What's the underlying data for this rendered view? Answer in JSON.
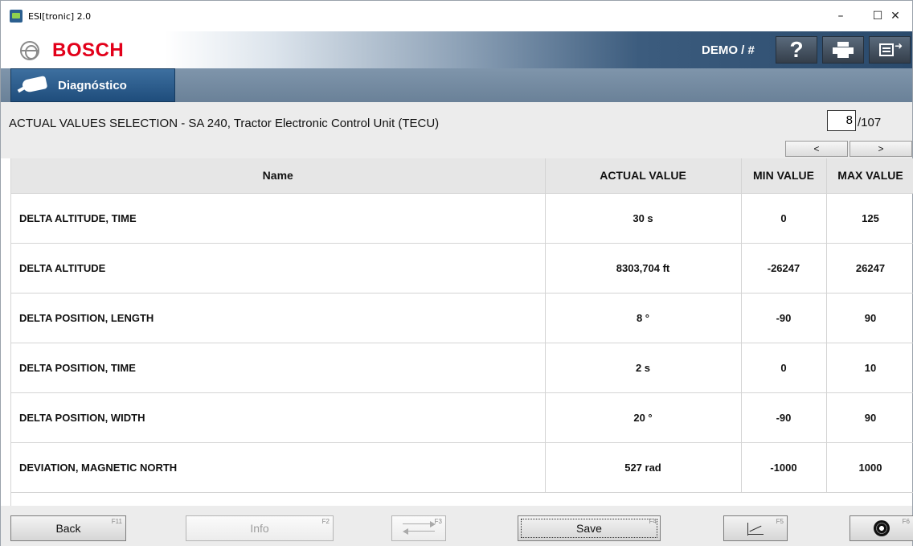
{
  "window": {
    "title": "ESI[tronic] 2.0",
    "minimize": "–",
    "maximize": "☐",
    "close": "✕"
  },
  "header": {
    "brand": "BOSCH",
    "user": "DEMO / #",
    "help_label": "?"
  },
  "nav": {
    "tab_label": "Diagnóstico"
  },
  "section": {
    "title": "ACTUAL VALUES SELECTION - SA 240, Tractor Electronic Control Unit (TECU)",
    "page_current": "8",
    "page_total": "/107",
    "prev_label": "<",
    "next_label": ">"
  },
  "table": {
    "headers": {
      "name": "Name",
      "actual": "ACTUAL VALUE",
      "min": "MIN VALUE",
      "max": "MAX VALUE"
    },
    "rows": [
      {
        "name": "DELTA ALTITUDE, TIME",
        "actual": "30 s",
        "min": "0",
        "max": "125"
      },
      {
        "name": "DELTA ALTITUDE",
        "actual": "8303,704 ft",
        "min": "-26247",
        "max": "26247"
      },
      {
        "name": "DELTA POSITION, LENGTH",
        "actual": "8 °",
        "min": "-90",
        "max": "90"
      },
      {
        "name": "DELTA POSITION, TIME",
        "actual": "2 s",
        "min": "0",
        "max": "10"
      },
      {
        "name": "DELTA POSITION, WIDTH",
        "actual": "20 °",
        "min": "-90",
        "max": "90"
      },
      {
        "name": "DEVIATION, MAGNETIC NORTH",
        "actual": "527 rad",
        "min": "-1000",
        "max": "1000"
      }
    ]
  },
  "footer": {
    "back_label": "Back",
    "back_key": "F11",
    "info_label": "Info",
    "info_key": "F2",
    "swap_key": "F3",
    "save_label": "Save",
    "save_key": "F4",
    "measure_key": "F5",
    "settings_key": "F6"
  }
}
